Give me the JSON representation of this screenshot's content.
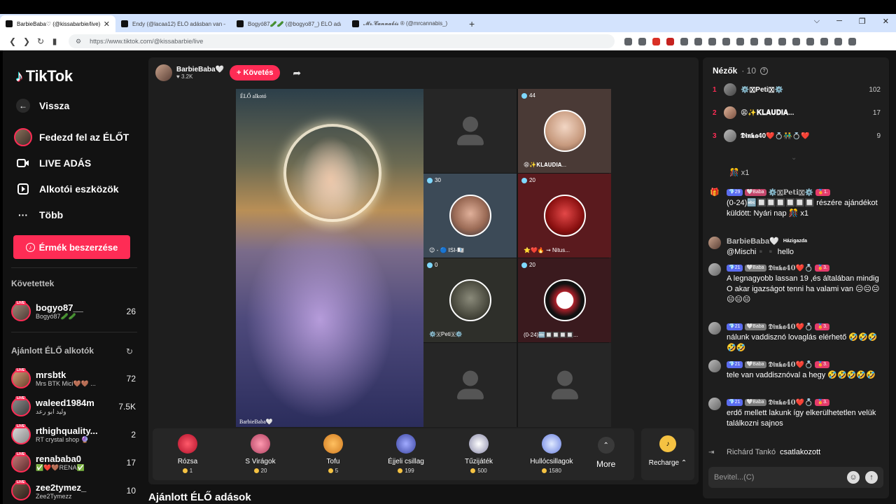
{
  "browser": {
    "tabs": [
      {
        "title": "BarbieBaba♡ (@kissabarbie/live)",
        "active": true
      },
      {
        "title": "Endy (@lacaa12) ÉLŐ adásban van –",
        "active": false
      },
      {
        "title": "Bogyó87🥒🥒 (@bogyo87_) ÉLŐ adá",
        "active": false
      },
      {
        "title": "𝓜𝓻.𝓒𝓪𝓷𝓷𝓪𝓫𝓲𝓼 ® (@mrcannabis_)",
        "active": false
      }
    ],
    "close_glyph": "✕",
    "newtab_glyph": "+",
    "window_controls": [
      "⌵",
      "─",
      "❐",
      "✕"
    ],
    "url": "https://www.tiktok.com/@kissabarbie/live"
  },
  "sidebar": {
    "logo": "TikTok",
    "back": "Vissza",
    "nav": [
      {
        "label": "Fedezd fel az ÉLŐT",
        "icon": "avatar"
      },
      {
        "label": "LIVE ADÁS",
        "icon": "camera-icon"
      },
      {
        "label": "Alkotói eszközök",
        "icon": "creator-tools-icon"
      },
      {
        "label": "Több",
        "icon": "more-dots-icon"
      }
    ],
    "coins_button": "Érmék beszerzése",
    "following_title": "Követettek",
    "following": [
      {
        "name": "bogyo87__",
        "sub": "Bogyó87🥒🥒",
        "count": "26"
      }
    ],
    "recommended_title": "Ajánlott ÉLŐ alkotók",
    "recommended": [
      {
        "name": "mrsbtk",
        "sub": "Mrs BTK Mici🤎🤎 ...",
        "count": "72"
      },
      {
        "name": "waleed1984m",
        "sub": "وليد ابو رعد",
        "count": "7.5K"
      },
      {
        "name": "rthighquality...",
        "sub": "RT crystal shop 🔮",
        "count": "2"
      },
      {
        "name": "renababa0",
        "sub": "✅❤️🤎RENA✅",
        "count": "17"
      },
      {
        "name": "zee2tymez_",
        "sub": "Zee2Tymezz",
        "count": "10"
      }
    ],
    "live_tag": "LIVE"
  },
  "stream": {
    "host_name": "BarbieBaba🤍",
    "host_likes": "♥ 3.2K",
    "follow_label": "+ Követés",
    "host_label_top": "ÉLŐ alkotó",
    "host_label_bottom": "BarbieBaba🤍",
    "slots": [
      {
        "badge": "",
        "name": ""
      },
      {
        "badge": "44",
        "name": "😩✨𝐊𝐋𝐀𝐔𝐃𝐈𝐀..."
      },
      {
        "badge": "30",
        "name": "😉 - 🔵 ISI-🇽🇽"
      },
      {
        "badge": "20",
        "name": "⭐❤️🔥 ⇝ Nitus..."
      },
      {
        "badge": "0",
        "name": "⚙️🇽Peti🇽⚙️"
      },
      {
        "badge": "20",
        "name": "(0-24)🔤🔲🔲🔲🔲..."
      },
      {
        "badge": "",
        "name": ""
      },
      {
        "badge": "",
        "name": ""
      }
    ],
    "gifts": [
      {
        "name": "Rózsa",
        "price": "1",
        "color": "#e8334a"
      },
      {
        "name": "S Virágok",
        "price": "20",
        "color": "#d95b7a"
      },
      {
        "name": "Tofu",
        "price": "5",
        "color": "#f2a53a"
      },
      {
        "name": "Éjjeli csillag",
        "price": "199",
        "color": "#6c7bd9"
      },
      {
        "name": "Tűzijáték",
        "price": "500",
        "color": "#c8c8d8"
      },
      {
        "name": "Hullócsillagok",
        "price": "1580",
        "color": "#9fb6ff"
      }
    ],
    "more_label": "More",
    "recharge_label": "Recharge ⌃",
    "recommend_title": "Ajánlott ÉLŐ adások"
  },
  "viewers": {
    "title": "Nézők",
    "count": "· 10",
    "top": [
      {
        "rank": "1",
        "name": "⚙️🇽Peti🇽⚙️",
        "score": "102"
      },
      {
        "rank": "2",
        "name": "😩✨𝐊𝐋𝐀𝐔𝐃𝐈𝐀...",
        "score": "17"
      },
      {
        "rank": "3",
        "name": "𝕯𝖎𝖓𝖐𝖆40❤️💍👬💍❤️",
        "score": "9"
      }
    ]
  },
  "chat": {
    "gift_line": "🎊 x1",
    "messages": [
      {
        "tags": [
          "💎29",
          "🤍Baba"
        ],
        "name": "⚙️🇽Peti🇽⚙️",
        "extra": "🏅1.",
        "text": "(0-24)🔤🔲🔲🔲🔲🔲🔲 részére ajándékot küldött: Nyári nap 🎊 x1"
      },
      {
        "tags": [],
        "name": "BarbieBaba🤍",
        "extra": "Házigazda",
        "text": "@Mischi▪️▪️ hello"
      },
      {
        "tags": [
          "💎21",
          "🤍Baba"
        ],
        "name": "𝕯𝖎𝖓𝖐𝖆40❤️💍",
        "extra": "🏅3.",
        "text": "A legnagyobb lassan 19 ,és általában mindig O akar igazságot tenni ha valami van 😑😑😑😑😑😑"
      },
      {
        "tags": [
          "💎21",
          "🤍Baba"
        ],
        "name": "𝕯𝖎𝖓𝖐𝖆40❤️💍",
        "extra": "🏅3.",
        "text": "nálunk vaddisznó lovaglás elérhető 🤣🤣🤣🤣🤣"
      },
      {
        "tags": [
          "💎21",
          "🤍Baba"
        ],
        "name": "𝕯𝖎𝖓𝖐𝖆40❤️💍",
        "extra": "🏅3.",
        "text": "tele van vaddisznóval a hegy 🤣🤣🤣🤣🤣"
      },
      {
        "tags": [
          "💎21",
          "🤍Baba"
        ],
        "name": "𝕯𝖎𝖓𝖐𝖆40❤️💍",
        "extra": "🏅3.",
        "text": "erdő mellett lakunk így elkerülhetetlen velük találkozni sajnos"
      }
    ],
    "join": {
      "name": "Richárd Tankó",
      "text": "csatlakozott"
    },
    "placeholder": "Bevitel...(C)"
  }
}
